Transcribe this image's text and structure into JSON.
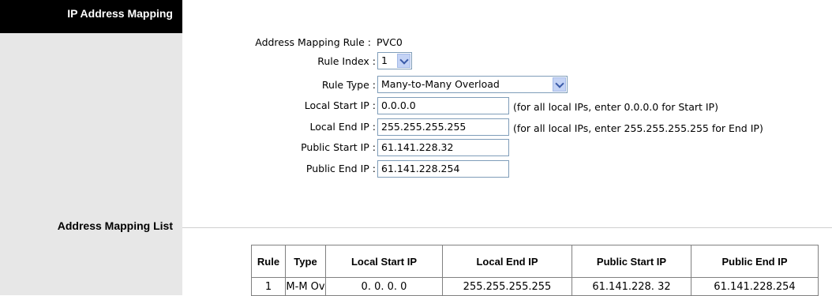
{
  "sidebar": {
    "title": "IP Address Mapping",
    "list_heading": "Address Mapping List"
  },
  "form": {
    "mapping_rule": {
      "label": "Address Mapping Rule :",
      "value": "PVC0"
    },
    "rule_index": {
      "label": "Rule Index :",
      "value": "1"
    },
    "rule_type": {
      "label": "Rule Type :",
      "value": "Many-to-Many Overload"
    },
    "local_start_ip": {
      "label": "Local Start IP :",
      "value": "0.0.0.0",
      "hint": "(for all local IPs, enter 0.0.0.0 for Start IP)"
    },
    "local_end_ip": {
      "label": "Local End IP :",
      "value": "255.255.255.255",
      "hint": "(for all local IPs, enter 255.255.255.255 for End IP)"
    },
    "public_start_ip": {
      "label": "Public Start IP :",
      "value": "61.141.228.32"
    },
    "public_end_ip": {
      "label": "Public End IP :",
      "value": "61.141.228.254"
    }
  },
  "table": {
    "headers": [
      "Rule",
      "Type",
      "Local Start IP",
      "Local End IP",
      "Public Start IP",
      "Public End IP"
    ],
    "rows": [
      [
        "1",
        "M-M Ov",
        "0. 0. 0. 0",
        "255.255.255.255",
        "61.141.228. 32",
        "61.141.228.254"
      ]
    ]
  },
  "icons": {
    "dropdown": "chevron-down-icon"
  }
}
